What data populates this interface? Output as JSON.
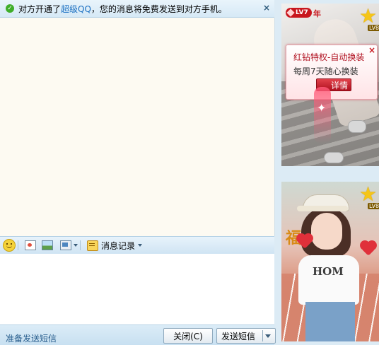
{
  "notice": {
    "text_before": "对方开通了",
    "link_text": "超级QQ",
    "text_after": "，您的消息将免费发送到对方手机。",
    "close_symbol": "×"
  },
  "toolbar": {
    "history_label": "消息记录"
  },
  "bottom": {
    "status": "准备发送短信",
    "close_label": "关闭(C)",
    "send_label": "发送短信"
  },
  "show_panel_1": {
    "level_badge": "LV7",
    "year_badge": "年",
    "star_level": "LV8",
    "promo": {
      "title": "红钻特权-自动换装",
      "subtitle": "每周7天随心换装",
      "detail_button": "详情",
      "close_symbol": "×"
    }
  },
  "show_panel_2": {
    "star_level": "LV8",
    "charm_text": "福",
    "shirt_text": "HOM"
  },
  "colors": {
    "accent_blue": "#1a6fc1",
    "status_text": "#2a5f8e",
    "promo_red": "#c8161d",
    "chat_background": "#fdfaf2",
    "window_background": "#dcebf5"
  },
  "icons": [
    "check-icon",
    "close-icon",
    "emoji-icon",
    "screenshot-icon",
    "picture-icon",
    "more-icon",
    "message-history-icon",
    "chevron-down-icon",
    "star-icon",
    "heart-icon"
  ]
}
